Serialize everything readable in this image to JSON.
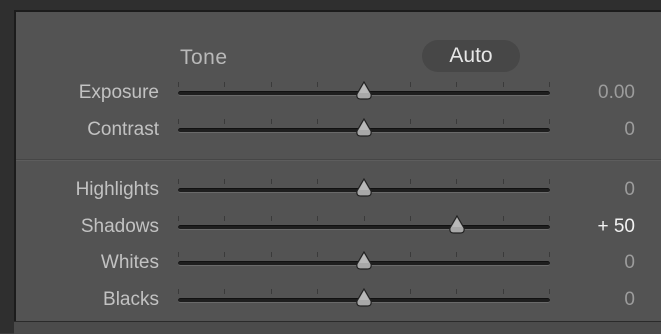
{
  "panel": {
    "section_title": "Tone",
    "auto_label": "Auto"
  },
  "sliders": [
    {
      "label": "Exposure",
      "value": "0.00",
      "level": 0.5,
      "active": false
    },
    {
      "label": "Contrast",
      "value": "0",
      "level": 0.5,
      "active": false
    },
    {
      "label": "Highlights",
      "value": "0",
      "level": 0.5,
      "active": false
    },
    {
      "label": "Shadows",
      "value": "+ 50",
      "level": 0.75,
      "active": true
    },
    {
      "label": "Whites",
      "value": "0",
      "level": 0.5,
      "active": false
    },
    {
      "label": "Blacks",
      "value": "0",
      "level": 0.5,
      "active": false
    }
  ],
  "colors": {
    "panel": "#535353",
    "track": "#1e1e1e",
    "thumb": "#a8a8a8",
    "active_value": "#f2f2f2",
    "inactive_value": "#9c9c9c"
  },
  "icons": {
    "slider_thumb": "triangle-thumb-icon"
  }
}
